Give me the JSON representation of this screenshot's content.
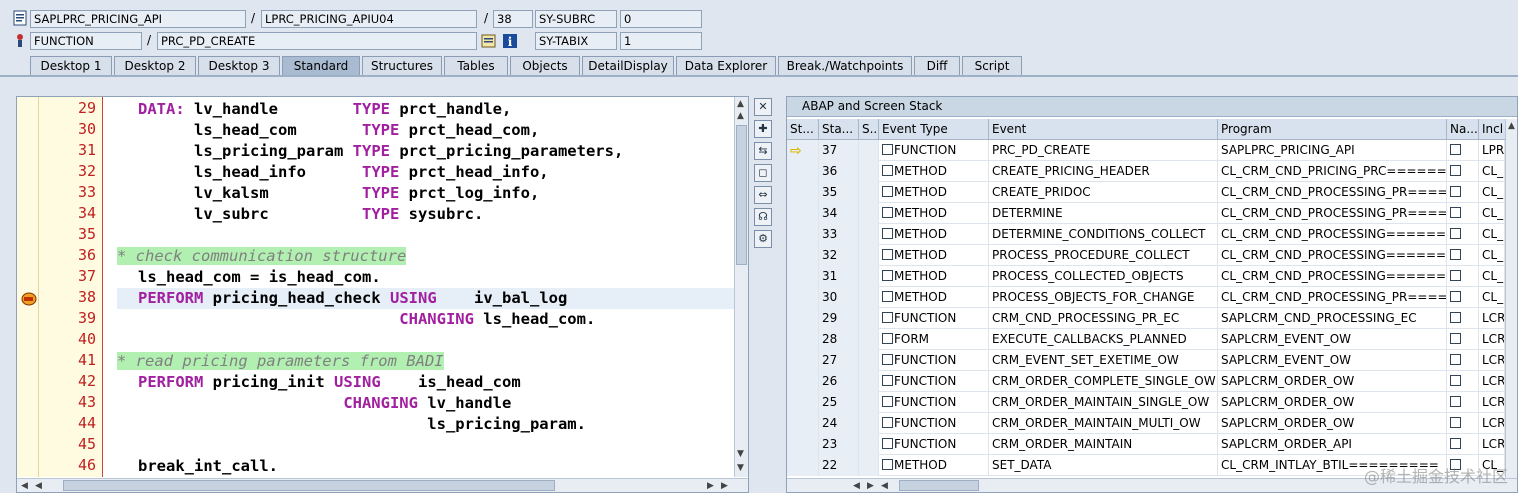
{
  "header": {
    "row1": {
      "program": "SAPLPRC_PRICING_API",
      "include": "LPRC_PRICING_APIU04",
      "line": "38",
      "sysvar": "SY-SUBRC",
      "sysval": "0"
    },
    "row2": {
      "event_type": "FUNCTION",
      "event_name": "PRC_PD_CREATE",
      "sysvar": "SY-TABIX",
      "sysval": "1"
    },
    "separator": "/"
  },
  "tabs": [
    "Desktop 1",
    "Desktop 2",
    "Desktop 3",
    "Standard",
    "Structures",
    "Tables",
    "Objects",
    "DetailDisplay",
    "Data Explorer",
    "Break./Watchpoints",
    "Diff",
    "Script"
  ],
  "active_tab": "Standard",
  "code": {
    "line_numbers": [
      "29",
      "30",
      "31",
      "32",
      "33",
      "34",
      "35",
      "36",
      "37",
      "38",
      "39",
      "40",
      "41",
      "42",
      "43",
      "44",
      "45",
      "46"
    ],
    "lines": [
      "DATA: lv_handle        TYPE prct_handle,",
      "      ls_head_com       TYPE prct_head_com,",
      "      ls_pricing_param TYPE prct_pricing_parameters,",
      "      ls_head_info      TYPE prct_head_info,",
      "      lv_kalsm          TYPE prct_log_info,",
      "      lv_subrc          TYPE sysubrc.",
      "",
      "* check communication structure",
      "ls_head_com = is_head_com.",
      "PERFORM pricing_head_check USING    iv_bal_log",
      "                            CHANGING ls_head_com.",
      "",
      "* read pricing parameters from BADI",
      "PERFORM pricing_init USING    is_head_com",
      "                      CHANGING lv_handle",
      "                               ls_pricing_param.",
      "",
      "break_int_call."
    ]
  },
  "stack": {
    "title": "ABAP and Screen Stack",
    "columns": [
      "St...",
      "Sta...",
      "S...",
      "Event Type",
      "Event",
      "Program",
      "Na...",
      "Incl"
    ],
    "rows": [
      {
        "level": "37",
        "type": "FUNCTION",
        "event": "PRC_PD_CREATE",
        "program": "SAPLPRC_PRICING_API",
        "incl": "LPR",
        "current": true
      },
      {
        "level": "36",
        "type": "METHOD",
        "event": "CREATE_PRICING_HEADER",
        "program": "CL_CRM_CND_PRICING_PRC=======",
        "incl": "CL_"
      },
      {
        "level": "35",
        "type": "METHOD",
        "event": "CREATE_PRIDOC",
        "program": "CL_CRM_CND_PROCESSING_PR=====",
        "incl": "CL_"
      },
      {
        "level": "34",
        "type": "METHOD",
        "event": "DETERMINE",
        "program": "CL_CRM_CND_PROCESSING_PR=====",
        "incl": "CL_"
      },
      {
        "level": "33",
        "type": "METHOD",
        "event": "DETERMINE_CONDITIONS_COLLECT",
        "program": "CL_CRM_CND_PROCESSING=======",
        "incl": "CL_"
      },
      {
        "level": "32",
        "type": "METHOD",
        "event": "PROCESS_PROCEDURE_COLLECT",
        "program": "CL_CRM_CND_PROCESSING=======",
        "incl": "CL_"
      },
      {
        "level": "31",
        "type": "METHOD",
        "event": "PROCESS_COLLECTED_OBJECTS",
        "program": "CL_CRM_CND_PROCESSING=======",
        "incl": "CL_"
      },
      {
        "level": "30",
        "type": "METHOD",
        "event": "PROCESS_OBJECTS_FOR_CHANGE",
        "program": "CL_CRM_CND_PROCESSING_PR=====",
        "incl": "CL_"
      },
      {
        "level": "29",
        "type": "FUNCTION",
        "event": "CRM_CND_PROCESSING_PR_EC",
        "program": "SAPLCRM_CND_PROCESSING_EC",
        "incl": "LCR"
      },
      {
        "level": "28",
        "type": "FORM",
        "event": "EXECUTE_CALLBACKS_PLANNED",
        "program": "SAPLCRM_EVENT_OW",
        "incl": "LCR"
      },
      {
        "level": "27",
        "type": "FUNCTION",
        "event": "CRM_EVENT_SET_EXETIME_OW",
        "program": "SAPLCRM_EVENT_OW",
        "incl": "LCR"
      },
      {
        "level": "26",
        "type": "FUNCTION",
        "event": "CRM_ORDER_COMPLETE_SINGLE_OW",
        "program": "SAPLCRM_ORDER_OW",
        "incl": "LCR"
      },
      {
        "level": "25",
        "type": "FUNCTION",
        "event": "CRM_ORDER_MAINTAIN_SINGLE_OW",
        "program": "SAPLCRM_ORDER_OW",
        "incl": "LCR"
      },
      {
        "level": "24",
        "type": "FUNCTION",
        "event": "CRM_ORDER_MAINTAIN_MULTI_OW",
        "program": "SAPLCRM_ORDER_OW",
        "incl": "LCR"
      },
      {
        "level": "23",
        "type": "FUNCTION",
        "event": "CRM_ORDER_MAINTAIN",
        "program": "SAPLCRM_ORDER_API",
        "incl": "LCR"
      },
      {
        "level": "22",
        "type": "METHOD",
        "event": "SET_DATA",
        "program": "CL_CRM_INTLAY_BTIL=========",
        "incl": "CL_"
      }
    ]
  },
  "watermark": "@稀土掘金技术社区",
  "icons": {
    "current_line": "breakpoint-arrow-icon",
    "stack_current": "yellow-arrow-icon"
  }
}
